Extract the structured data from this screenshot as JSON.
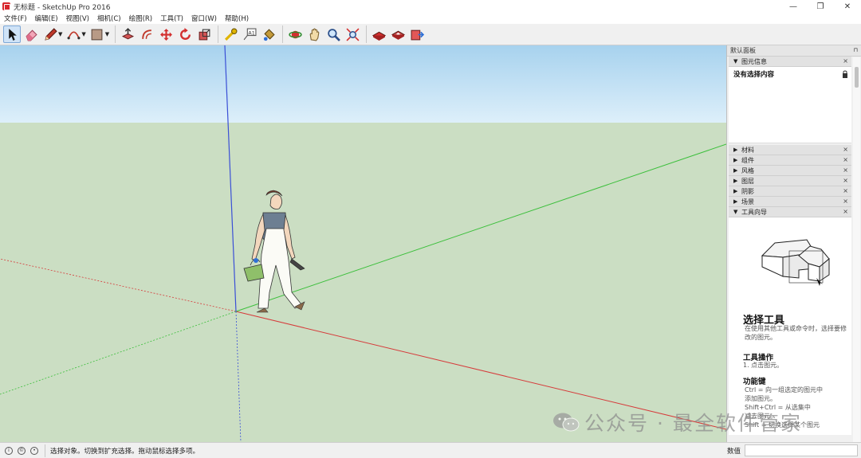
{
  "window": {
    "title": "无标题 - SketchUp Pro 2016",
    "controls": [
      "—",
      "❐",
      "✕"
    ]
  },
  "menu": [
    "文件(F)",
    "编辑(E)",
    "视图(V)",
    "相机(C)",
    "绘图(R)",
    "工具(T)",
    "窗口(W)",
    "帮助(H)"
  ],
  "toolbar": {
    "groups": [
      [
        "select-tool",
        "eraser-tool",
        "pencil-tool",
        "arc-tool",
        "shape-tool"
      ],
      [
        "push-pull-tool",
        "offset-tool",
        "move-tool",
        "rotate-tool",
        "scale-tool"
      ],
      [
        "tape-measure-tool",
        "text-tool",
        "paint-bucket-tool"
      ],
      [
        "orbit-tool",
        "pan-tool",
        "zoom-tool",
        "zoom-extents-tool"
      ],
      [
        "warehouse-tool",
        "extension-warehouse-tool",
        "send-to-layout-tool"
      ]
    ],
    "text_tool_label": "A1"
  },
  "panel": {
    "title": "默认面板",
    "entity_info": {
      "label": "图元信息",
      "content": "没有选择内容"
    },
    "trays": [
      "材料",
      "组件",
      "风格",
      "图层",
      "阴影",
      "场景"
    ],
    "instructor": {
      "label": "工具向导",
      "tool_name": "选择工具",
      "description": "在使用其他工具或命令时，选择要修改的图元。",
      "operation_title": "工具操作",
      "operation_step": "1.   点击图元。",
      "modifier_title": "功能键",
      "modifier_lines": [
        "Ctrl = 向一组选定的图元中",
        "添加图元。",
        "Shift+Ctrl = 从选集中",
        "减去图元。",
        "Shift = 切换选择某个图元"
      ]
    }
  },
  "status": {
    "message": "选择对象。切换到扩充选择。拖动鼠标选择多项。",
    "measurements_label": "数值",
    "icons": [
      "geo-location-icon",
      "credit-icon",
      "user-icon"
    ]
  },
  "watermark": "公众号 · 最全软件管家",
  "colors": {
    "sky_top": "#a7d2ee",
    "ground": "#cbdec3",
    "axis_red": "#d63a3a",
    "axis_green": "#3bbf3b",
    "axis_blue": "#3a4fd6"
  }
}
